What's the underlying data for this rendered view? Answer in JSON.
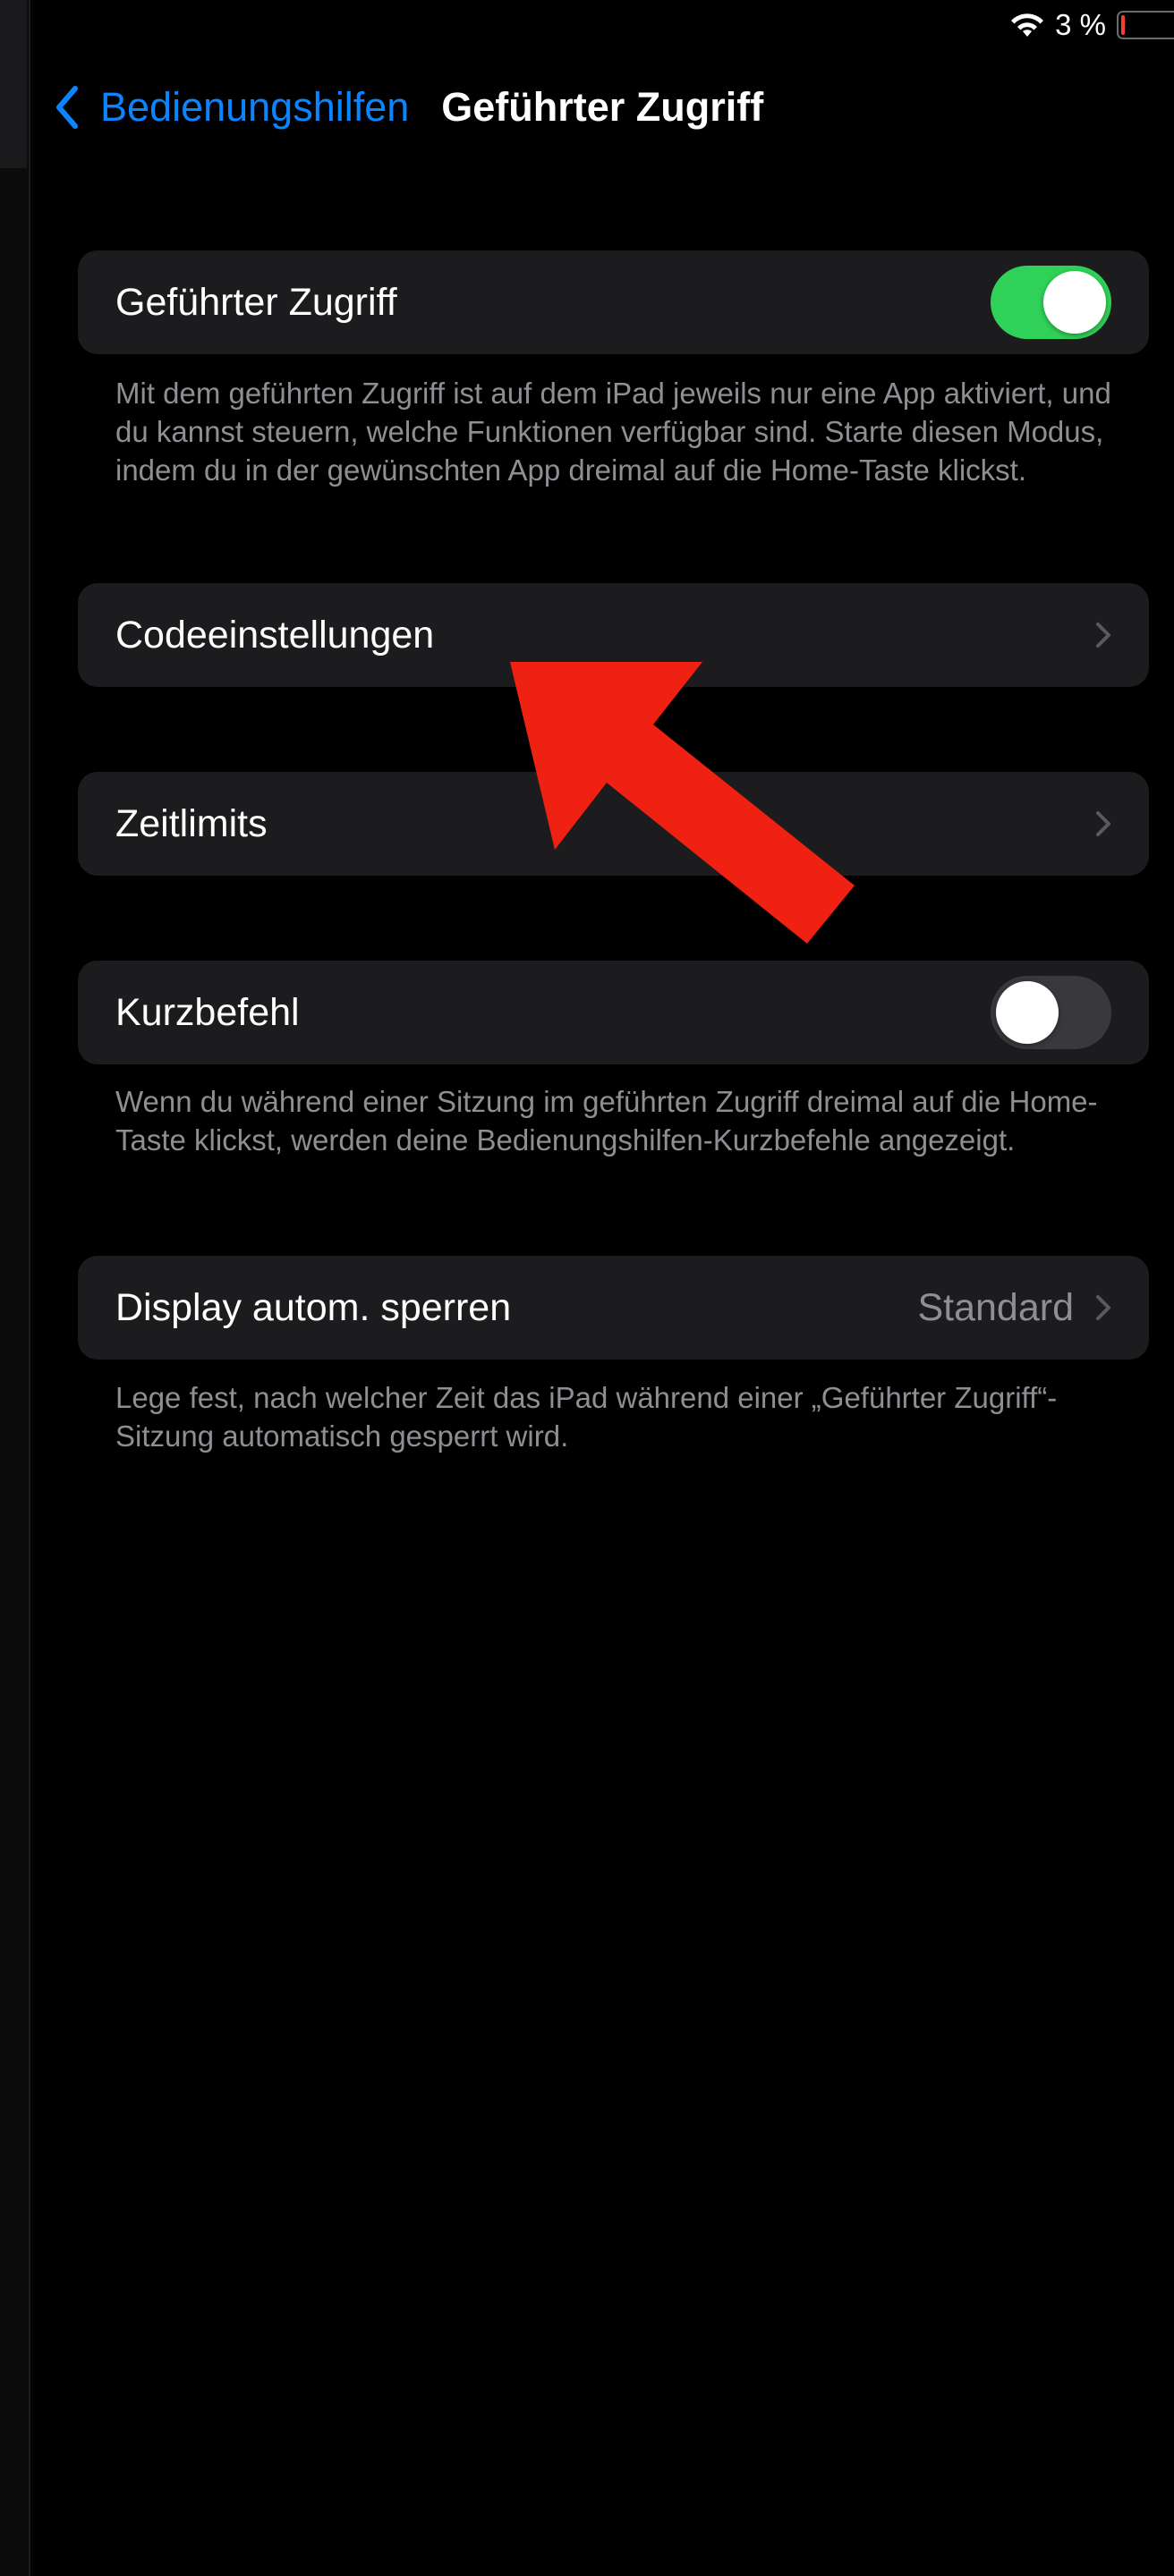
{
  "status_bar": {
    "battery_percent": "3 %"
  },
  "nav": {
    "back_label": "Bedienungshilfen",
    "title": "Geführter Zugriff"
  },
  "guided_access": {
    "label": "Geführter Zugriff",
    "enabled": true,
    "footer": "Mit dem geführten Zugriff ist auf dem iPad jeweils nur eine App aktiviert, und du kannst steuern, welche Funktionen verfügbar sind. Starte diesen Modus, indem du in der gewünschten App dreimal auf die Home-Taste klickst."
  },
  "passcode_settings": {
    "label": "Codeeinstellungen"
  },
  "time_limits": {
    "label": "Zeitlimits"
  },
  "shortcut": {
    "label": "Kurzbefehl",
    "enabled": false,
    "footer": "Wenn du während einer Sitzung im geführten Zugriff dreimal auf die Home-Taste klickst, werden deine Bedienungshilfen-Kurzbefehle angezeigt."
  },
  "auto_lock": {
    "label": "Display autom. sperren",
    "value": "Standard",
    "footer": "Lege fest, nach welcher Zeit das iPad während einer „Geführter Zugriff“-Sitzung automatisch gesperrt wird."
  },
  "colors": {
    "accent": "#0a84ff",
    "toggle_on": "#30d158",
    "cell": "#1c1c1e",
    "annotation_arrow": "#ee2112"
  }
}
